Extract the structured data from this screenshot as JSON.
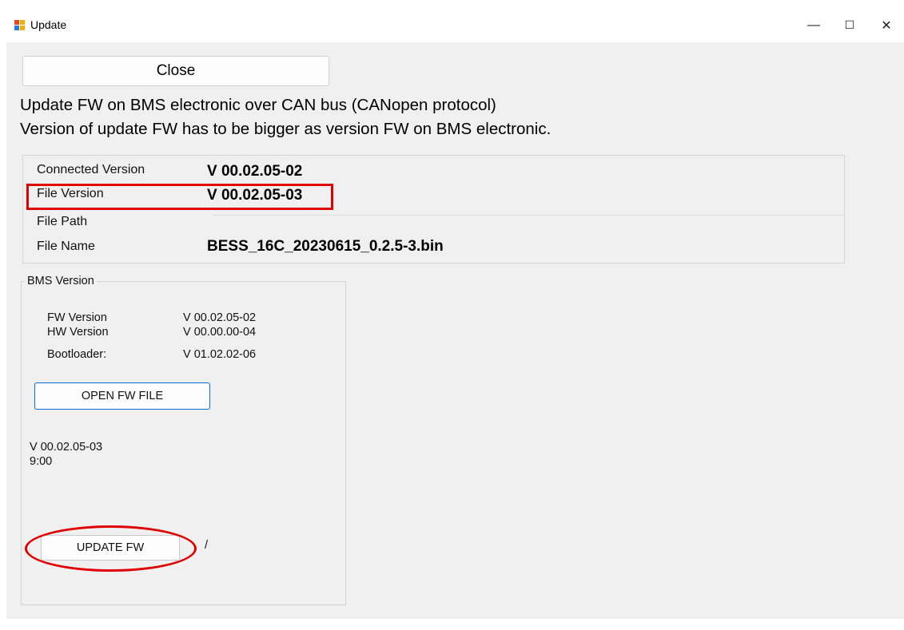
{
  "window": {
    "title": "Update",
    "controls": {
      "minimize": "—",
      "maximize": "☐",
      "close": "✕"
    }
  },
  "toolbar": {
    "close_label": "Close"
  },
  "description": {
    "line1": "Update FW on BMS electronic over CAN bus (CANopen protocol)",
    "line2": "Version of update FW has to be bigger as version FW on BMS electronic."
  },
  "info": {
    "connected_version_label": "Connected Version",
    "connected_version_value": "V 00.02.05-02",
    "file_version_label": "File Version",
    "file_version_value": "V 00.02.05-03",
    "file_path_label": "File Path",
    "file_name_label": "File Name",
    "file_name_value": "BESS_16C_20230615_0.2.5-3.bin"
  },
  "bms": {
    "group_title": "BMS Version",
    "fw_label": "FW Version",
    "fw_value": "V 00.02.05-02",
    "hw_label": "HW Version",
    "hw_value": "V 00.00.00-04",
    "bootloader_label": "Bootloader:",
    "bootloader_value": "V 01.02.02-06",
    "open_button_label": "OPEN FW FILE",
    "loaded_version": "V 00.02.05-03",
    "loaded_time": "9:00",
    "update_button_label": "UPDATE FW",
    "update_status": "/"
  },
  "colors": {
    "annotation": "#e00000",
    "focus_border": "#0a6fd1",
    "window_bg": "#f0f0f0"
  }
}
